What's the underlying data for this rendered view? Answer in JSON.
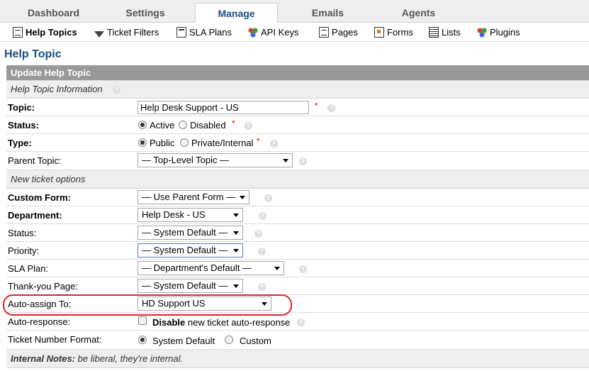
{
  "top_tabs": [
    "Dashboard",
    "Settings",
    "Manage",
    "Emails",
    "Agents"
  ],
  "sub_nav": [
    {
      "label": "Help Topics",
      "icon": "document-icon"
    },
    {
      "label": "Ticket Filters",
      "icon": "funnel-icon"
    },
    {
      "label": "SLA Plans",
      "icon": "sla-icon"
    },
    {
      "label": "API Keys",
      "icon": "api-keys-icon"
    },
    {
      "label": "Pages",
      "icon": "pages-icon"
    },
    {
      "label": "Forms",
      "icon": "forms-icon"
    },
    {
      "label": "Lists",
      "icon": "lists-icon"
    },
    {
      "label": "Plugins",
      "icon": "plugins-icon"
    }
  ],
  "page_title": "Help Topic",
  "form": {
    "header": "Update Help Topic",
    "section_info": "Help Topic Information",
    "topic_label": "Topic:",
    "topic_value": "Help Desk Support - US",
    "status_label": "Status:",
    "status_active": "Active",
    "status_disabled": "Disabled",
    "type_label": "Type:",
    "type_public": "Public",
    "type_private": "Private/Internal",
    "parent_label": "Parent Topic:",
    "parent_value": "— Top-Level Topic —",
    "section_ticket": "New ticket options",
    "custom_form_label": "Custom Form:",
    "custom_form_value": "— Use Parent Form —",
    "department_label": "Department:",
    "department_value": "Help Desk - US",
    "status2_label": "Status:",
    "status2_value": "— System Default —",
    "priority_label": "Priority:",
    "priority_value": "— System Default —",
    "sla_label": "SLA Plan:",
    "sla_value": "— Department's Default —",
    "thankyou_label": "Thank-you Page:",
    "thankyou_value": "— System Default —",
    "autoassign_label": "Auto-assign To:",
    "autoassign_value": "HD Support US",
    "autoresponse_label": "Auto-response:",
    "autoresponse_bold": "Disable",
    "autoresponse_text": "new ticket auto-response",
    "ticketnum_label": "Ticket Number Format:",
    "ticketnum_system": "System Default",
    "ticketnum_custom": "Custom",
    "notes_label": "Internal Notes:",
    "notes_text": "be liberal, they're internal."
  },
  "required_mark": "*",
  "help_glyph": "?",
  "colors": {
    "brand": "#184e81",
    "required": "#e00000",
    "highlight": "#d8272a"
  }
}
